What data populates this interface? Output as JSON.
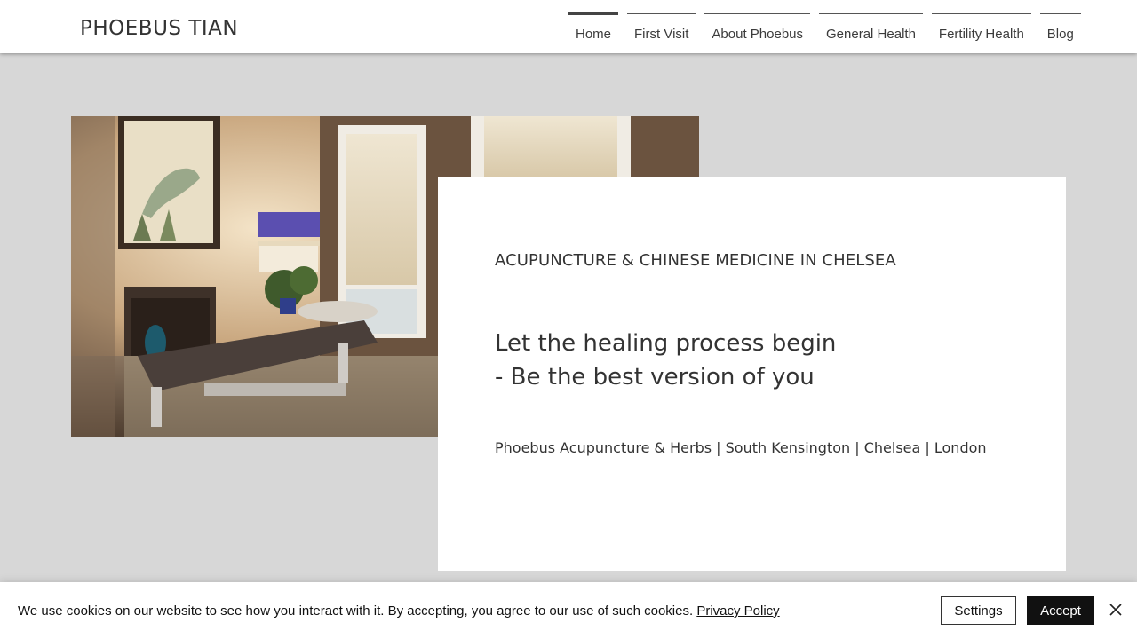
{
  "header": {
    "logo": "PHOEBUS TIAN",
    "nav": [
      {
        "label": "Home",
        "active": true
      },
      {
        "label": "First Visit"
      },
      {
        "label": "About Phoebus"
      },
      {
        "label": "General Health"
      },
      {
        "label": "Fertility Health"
      },
      {
        "label": "Blog"
      }
    ]
  },
  "hero": {
    "image_icon": "treatment-room-photo"
  },
  "card": {
    "eyebrow": "ACUPUNCTURE & CHINESE MEDICINE IN CHELSEA",
    "headline_line1": "Let the healing process begin",
    "headline_line2": "- Be the best version of you",
    "tagline": "Phoebus Acupuncture & Herbs | South Kensington | Chelsea | London"
  },
  "cookie": {
    "text": "We use cookies on our website to see how you interact with it. By accepting, you agree to our use of such cookies.",
    "privacy_link": "Privacy Policy",
    "settings_label": "Settings",
    "accept_label": "Accept",
    "close_icon": "close-icon"
  },
  "colors": {
    "page_bg": "#d7d7d7",
    "card_bg": "#ffffff",
    "text": "#333333",
    "accept_bg": "#111111"
  }
}
